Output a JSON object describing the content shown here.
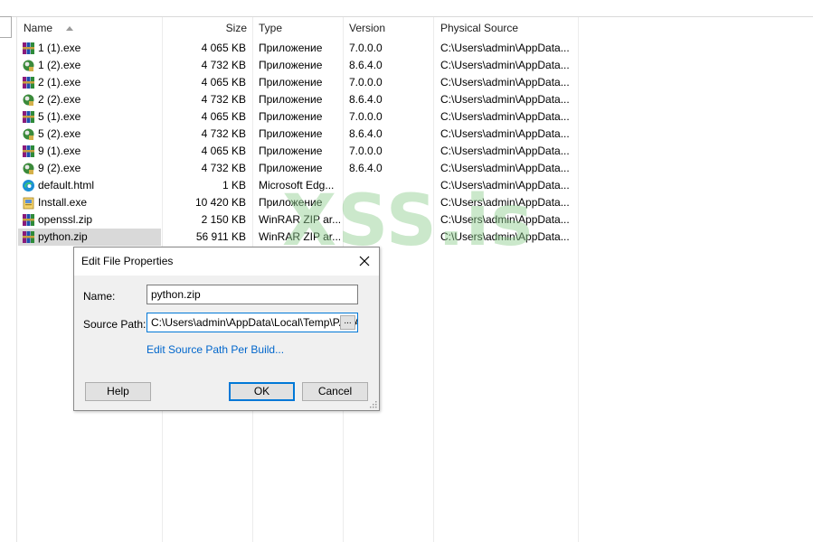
{
  "columns": {
    "name": "Name",
    "size": "Size",
    "type": "Type",
    "version": "Version",
    "source": "Physical Source"
  },
  "files": [
    {
      "name": "1 (1).exe",
      "size": "4 065 KB",
      "type": "Приложение",
      "version": "7.0.0.0",
      "source": "C:\\Users\\admin\\AppData...",
      "icon": "winrar-icon"
    },
    {
      "name": "1 (2).exe",
      "size": "4 732 KB",
      "type": "Приложение",
      "version": "8.6.4.0",
      "source": "C:\\Users\\admin\\AppData...",
      "icon": "python-setup-icon"
    },
    {
      "name": "2 (1).exe",
      "size": "4 065 KB",
      "type": "Приложение",
      "version": "7.0.0.0",
      "source": "C:\\Users\\admin\\AppData...",
      "icon": "winrar-icon"
    },
    {
      "name": "2 (2).exe",
      "size": "4 732 KB",
      "type": "Приложение",
      "version": "8.6.4.0",
      "source": "C:\\Users\\admin\\AppData...",
      "icon": "python-setup-icon"
    },
    {
      "name": "5 (1).exe",
      "size": "4 065 KB",
      "type": "Приложение",
      "version": "7.0.0.0",
      "source": "C:\\Users\\admin\\AppData...",
      "icon": "winrar-icon"
    },
    {
      "name": "5 (2).exe",
      "size": "4 732 KB",
      "type": "Приложение",
      "version": "8.6.4.0",
      "source": "C:\\Users\\admin\\AppData...",
      "icon": "python-setup-icon"
    },
    {
      "name": "9 (1).exe",
      "size": "4 065 KB",
      "type": "Приложение",
      "version": "7.0.0.0",
      "source": "C:\\Users\\admin\\AppData...",
      "icon": "winrar-icon"
    },
    {
      "name": "9 (2).exe",
      "size": "4 732 KB",
      "type": "Приложение",
      "version": "8.6.4.0",
      "source": "C:\\Users\\admin\\AppData...",
      "icon": "python-setup-icon"
    },
    {
      "name": "default.html",
      "size": "1 KB",
      "type": "Microsoft Edg...",
      "version": "",
      "source": "C:\\Users\\admin\\AppData...",
      "icon": "edge-icon"
    },
    {
      "name": "Install.exe",
      "size": "10 420 KB",
      "type": "Приложение",
      "version": "",
      "source": "C:\\Users\\admin\\AppData...",
      "icon": "installer-icon"
    },
    {
      "name": "openssl.zip",
      "size": "2 150 KB",
      "type": "WinRAR ZIP ar...",
      "version": "",
      "source": "C:\\Users\\admin\\AppData...",
      "icon": "winrar-icon"
    },
    {
      "name": "python.zip",
      "size": "56 911 KB",
      "type": "WinRAR ZIP ar...",
      "version": "",
      "source": "C:\\Users\\admin\\AppData...",
      "icon": "winrar-icon"
    }
  ],
  "selected_index": 11,
  "watermark": "XSS.is",
  "dialog": {
    "title": "Edit File Properties",
    "name_label": "Name:",
    "name_value": "python.zip",
    "source_label": "Source Path:",
    "source_value": "C:\\Users\\admin\\AppData\\Local\\Temp\\PACA",
    "browse_label": "...",
    "edit_link": "Edit Source Path Per Build...",
    "help_label": "Help",
    "ok_label": "OK",
    "cancel_label": "Cancel"
  },
  "colors": {
    "selection": "#d9d9d9",
    "link": "#0066cc",
    "focus": "#0078d7",
    "watermark": "#8ccd8c"
  }
}
